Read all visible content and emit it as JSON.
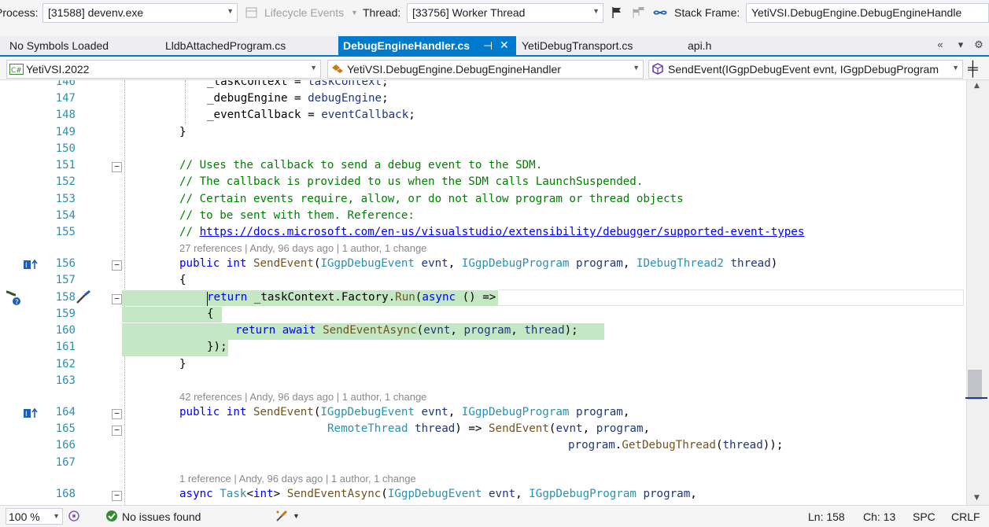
{
  "debug_toolbar": {
    "process_label": "Process:",
    "process_value": "[31588] devenv.exe",
    "lifecycle_label": "Lifecycle Events",
    "thread_label": "Thread:",
    "thread_value": "[33756] Worker Thread",
    "stack_frame_label": "Stack Frame:",
    "stack_frame_value": "YetiVSI.DebugEngine.DebugEngineHandle"
  },
  "tabs": [
    {
      "label": "No Symbols Loaded",
      "active": false
    },
    {
      "label": "LldbAttachedProgram.cs",
      "active": false
    },
    {
      "label": "DebugEngineHandler.cs",
      "active": true
    },
    {
      "label": "YetiDebugTransport.cs",
      "active": false
    },
    {
      "label": "api.h",
      "active": false
    }
  ],
  "navbar": {
    "project": "YetiVSI.2022",
    "class": "YetiVSI.DebugEngine.DebugEngineHandler",
    "member": "SendEvent(IGgpDebugEvent evnt, IGgpDebugProgram"
  },
  "code_lens": {
    "send_event_1": "27 references | Andy, 96 days ago | 1 author, 1 change",
    "send_event_2": "42 references | Andy, 96 days ago | 1 author, 1 change",
    "send_event_async": "1 reference | Andy, 96 days ago | 1 author, 1 change"
  },
  "line_numbers": [
    "146",
    "147",
    "148",
    "149",
    "150",
    "151",
    "152",
    "153",
    "154",
    "155",
    "156",
    "157",
    "158",
    "159",
    "160",
    "161",
    "162",
    "163",
    "164",
    "165",
    "166",
    "167",
    "168"
  ],
  "status": {
    "zoom": "100 %",
    "issues": "No issues found",
    "line": "Ln: 158",
    "char": "Ch: 13",
    "spaces": "SPC",
    "line_ending": "CRLF"
  },
  "colors": {
    "accent": "#007acc",
    "comment": "#008000",
    "keyword": "#0000ff",
    "type": "#2b91af",
    "highlight": "#c4e8c4"
  }
}
